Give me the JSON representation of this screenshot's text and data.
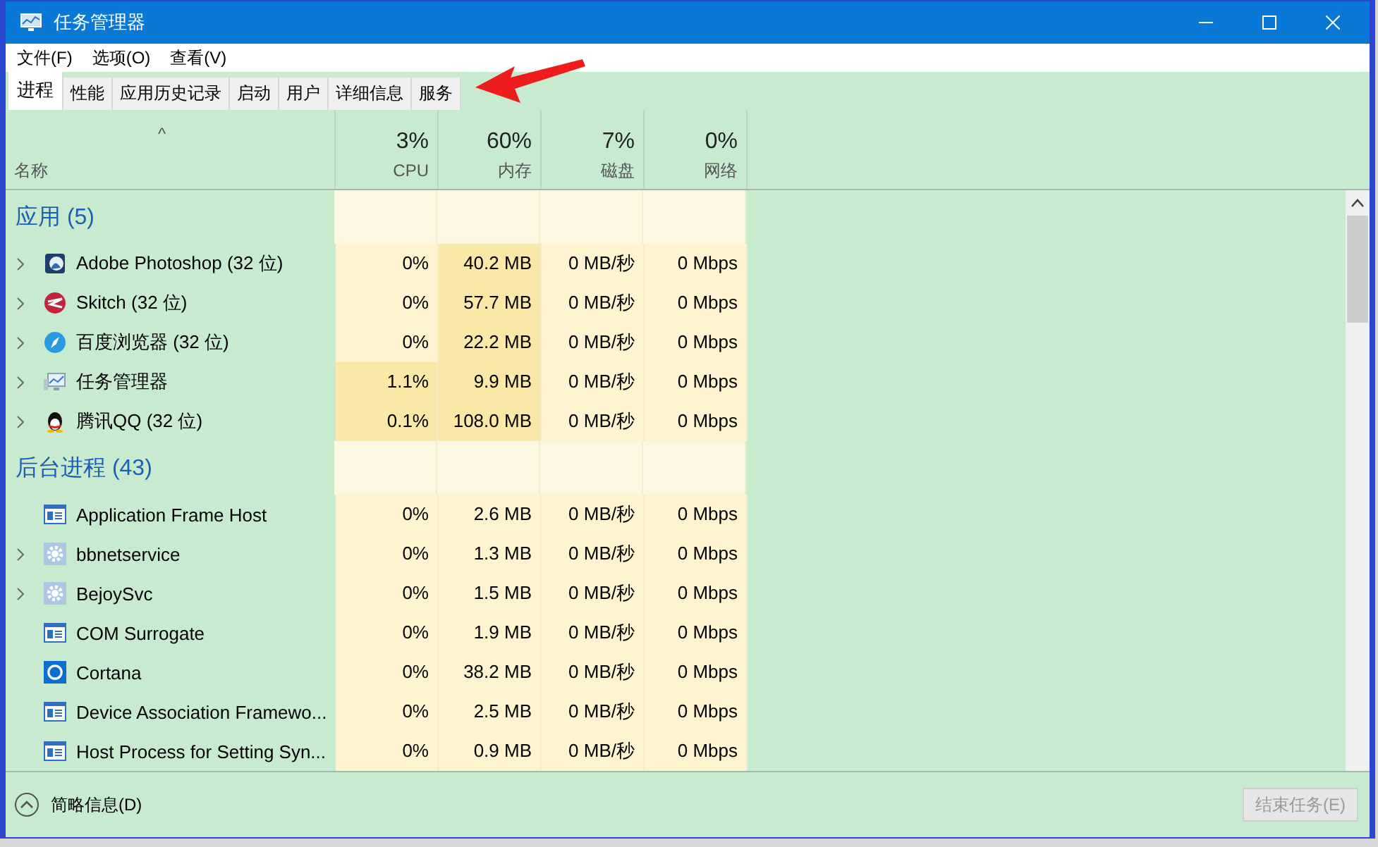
{
  "window": {
    "title": "任务管理器"
  },
  "menu": [
    "文件(F)",
    "选项(O)",
    "查看(V)"
  ],
  "tabs": [
    {
      "label": "进程",
      "selected": true
    },
    {
      "label": "性能",
      "selected": false
    },
    {
      "label": "应用历史记录",
      "selected": false
    },
    {
      "label": "启动",
      "selected": false
    },
    {
      "label": "用户",
      "selected": false
    },
    {
      "label": "详细信息",
      "selected": false
    },
    {
      "label": "服务",
      "selected": false
    }
  ],
  "table": {
    "name_column": "名称",
    "sort_indicator": "^",
    "columns": [
      {
        "total": "3%",
        "label": "CPU"
      },
      {
        "total": "60%",
        "label": "内存"
      },
      {
        "total": "7%",
        "label": "磁盘"
      },
      {
        "total": "0%",
        "label": "网络"
      }
    ],
    "groups": [
      {
        "title": "应用 (5)",
        "rows": [
          {
            "name": "Adobe Photoshop (32 位)",
            "kind": "photoshop",
            "expandable": true,
            "cells": [
              {
                "text": "0%",
                "highlighted": false
              },
              {
                "text": "40.2 MB",
                "highlighted": true
              },
              {
                "text": "0 MB/秒",
                "highlighted": false
              },
              {
                "text": "0 Mbps",
                "highlighted": false
              }
            ]
          },
          {
            "name": "Skitch (32 位)",
            "kind": "skitch",
            "expandable": true,
            "cells": [
              {
                "text": "0%",
                "highlighted": false
              },
              {
                "text": "57.7 MB",
                "highlighted": true
              },
              {
                "text": "0 MB/秒",
                "highlighted": false
              },
              {
                "text": "0 Mbps",
                "highlighted": false
              }
            ]
          },
          {
            "name": "百度浏览器 (32 位)",
            "kind": "browser",
            "expandable": true,
            "cells": [
              {
                "text": "0%",
                "highlighted": false
              },
              {
                "text": "22.2 MB",
                "highlighted": true
              },
              {
                "text": "0 MB/秒",
                "highlighted": false
              },
              {
                "text": "0 Mbps",
                "highlighted": false
              }
            ]
          },
          {
            "name": "任务管理器",
            "kind": "monitor",
            "expandable": true,
            "cells": [
              {
                "text": "1.1%",
                "highlighted": true
              },
              {
                "text": "9.9 MB",
                "highlighted": true
              },
              {
                "text": "0 MB/秒",
                "highlighted": false
              },
              {
                "text": "0 Mbps",
                "highlighted": false
              }
            ]
          },
          {
            "name": "腾讯QQ (32 位)",
            "kind": "penguin",
            "expandable": true,
            "cells": [
              {
                "text": "0.1%",
                "highlighted": true
              },
              {
                "text": "108.0 MB",
                "highlighted": true
              },
              {
                "text": "0 MB/秒",
                "highlighted": false
              },
              {
                "text": "0 Mbps",
                "highlighted": false
              }
            ]
          }
        ]
      },
      {
        "title": "后台进程 (43)",
        "rows": [
          {
            "name": "Application Frame Host",
            "kind": "window",
            "expandable": false,
            "cells": [
              {
                "text": "0%",
                "highlighted": false
              },
              {
                "text": "2.6 MB",
                "highlighted": false
              },
              {
                "text": "0 MB/秒",
                "highlighted": false
              },
              {
                "text": "0 Mbps",
                "highlighted": false
              }
            ]
          },
          {
            "name": "bbnetservice",
            "kind": "gear",
            "expandable": true,
            "cells": [
              {
                "text": "0%",
                "highlighted": false
              },
              {
                "text": "1.3 MB",
                "highlighted": false
              },
              {
                "text": "0 MB/秒",
                "highlighted": false
              },
              {
                "text": "0 Mbps",
                "highlighted": false
              }
            ]
          },
          {
            "name": "BejoySvc",
            "kind": "gear",
            "expandable": true,
            "cells": [
              {
                "text": "0%",
                "highlighted": false
              },
              {
                "text": "1.5 MB",
                "highlighted": false
              },
              {
                "text": "0 MB/秒",
                "highlighted": false
              },
              {
                "text": "0 Mbps",
                "highlighted": false
              }
            ]
          },
          {
            "name": "COM Surrogate",
            "kind": "window",
            "expandable": false,
            "cells": [
              {
                "text": "0%",
                "highlighted": false
              },
              {
                "text": "1.9 MB",
                "highlighted": false
              },
              {
                "text": "0 MB/秒",
                "highlighted": false
              },
              {
                "text": "0 Mbps",
                "highlighted": false
              }
            ]
          },
          {
            "name": "Cortana",
            "kind": "ring",
            "expandable": false,
            "cells": [
              {
                "text": "0%",
                "highlighted": false
              },
              {
                "text": "38.2 MB",
                "highlighted": false
              },
              {
                "text": "0 MB/秒",
                "highlighted": false
              },
              {
                "text": "0 Mbps",
                "highlighted": false
              }
            ]
          },
          {
            "name": "Device Association Framewo...",
            "kind": "window",
            "expandable": false,
            "cells": [
              {
                "text": "0%",
                "highlighted": false
              },
              {
                "text": "2.5 MB",
                "highlighted": false
              },
              {
                "text": "0 MB/秒",
                "highlighted": false
              },
              {
                "text": "0 Mbps",
                "highlighted": false
              }
            ]
          },
          {
            "name": "Host Process for Setting Syn...",
            "kind": "window",
            "expandable": false,
            "cells": [
              {
                "text": "0%",
                "highlighted": false
              },
              {
                "text": "0.9 MB",
                "highlighted": false
              },
              {
                "text": "0 MB/秒",
                "highlighted": false
              },
              {
                "text": "0 Mbps",
                "highlighted": false
              }
            ]
          }
        ]
      }
    ]
  },
  "footer": {
    "details_toggle": "简略信息(D)",
    "end_task": {
      "label": "结束任务(E)",
      "disabled": true
    }
  }
}
